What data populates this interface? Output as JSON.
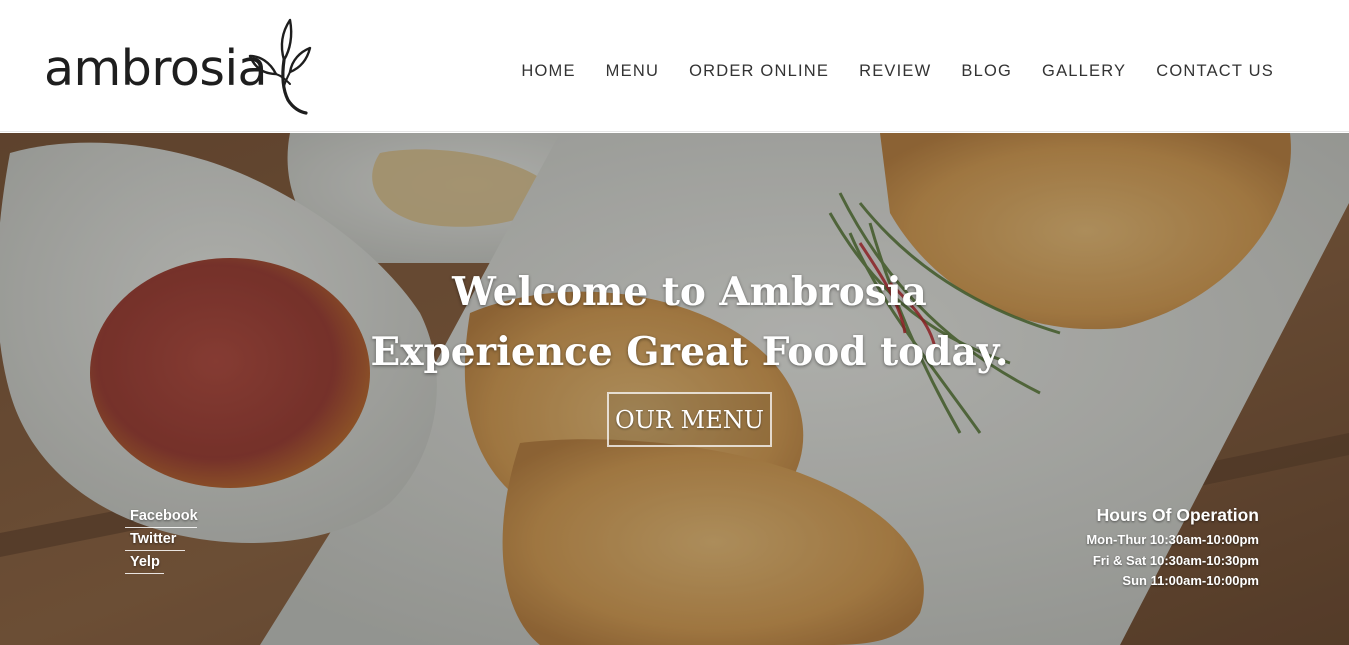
{
  "brand": {
    "name": "ambrosia",
    "colors": {
      "text": "#1e1e1e",
      "nav": "#333333",
      "overlay_text": "#ffffff"
    }
  },
  "nav": {
    "items": [
      {
        "label": "HOME"
      },
      {
        "label": "MENU"
      },
      {
        "label": "ORDER ONLINE"
      },
      {
        "label": "REVIEW"
      },
      {
        "label": "BLOG"
      },
      {
        "label": "GALLERY"
      },
      {
        "label": "CONTACT US"
      }
    ]
  },
  "hero": {
    "background": "photo-of-fried-wontons-with-red-dipping-sauce",
    "headline_1": "Welcome to Ambrosia",
    "headline_2": "Experience Great Food today.",
    "cta_label": "OUR MENU"
  },
  "social": {
    "links": [
      {
        "label": "Facebook"
      },
      {
        "label": "Twitter"
      },
      {
        "label": "Yelp"
      }
    ]
  },
  "hours": {
    "title": "Hours Of Operation",
    "lines": [
      "Mon-Thur 10:30am-10:00pm",
      "Fri & Sat 10:30am-10:30pm",
      "Sun 11:00am-10:00pm"
    ]
  }
}
